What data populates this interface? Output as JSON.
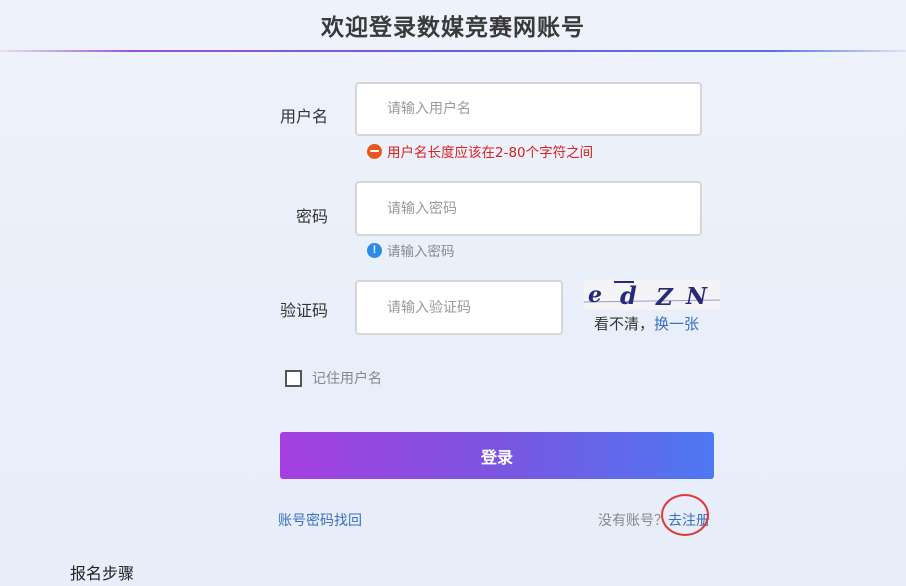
{
  "header": {
    "title": "欢迎登录数媒竞赛网账号"
  },
  "form": {
    "username": {
      "label": "用户名",
      "placeholder": "请输入用户名",
      "error": "用户名长度应该在2-80个字符之间"
    },
    "password": {
      "label": "密码",
      "placeholder": "请输入密码",
      "hint": "请输入密码",
      "hint_icon_glyph": "!"
    },
    "captcha": {
      "label": "验证码",
      "placeholder": "请输入验证码",
      "image_text": "edZN",
      "cant_see": "看不清，",
      "refresh": "换一张"
    },
    "remember_label": "记住用户名",
    "login_label": "登录",
    "recover_label": "账号密码找回",
    "no_account": "没有账号？",
    "register_label": "去注册"
  },
  "footer": {
    "steps_heading": "报名步骤"
  },
  "colors": {
    "error": "#d9231f",
    "link": "#3a6fc0",
    "button_start": "#a53fe0",
    "button_end": "#4d78f2",
    "annotation_circle": "#e03a3a"
  }
}
